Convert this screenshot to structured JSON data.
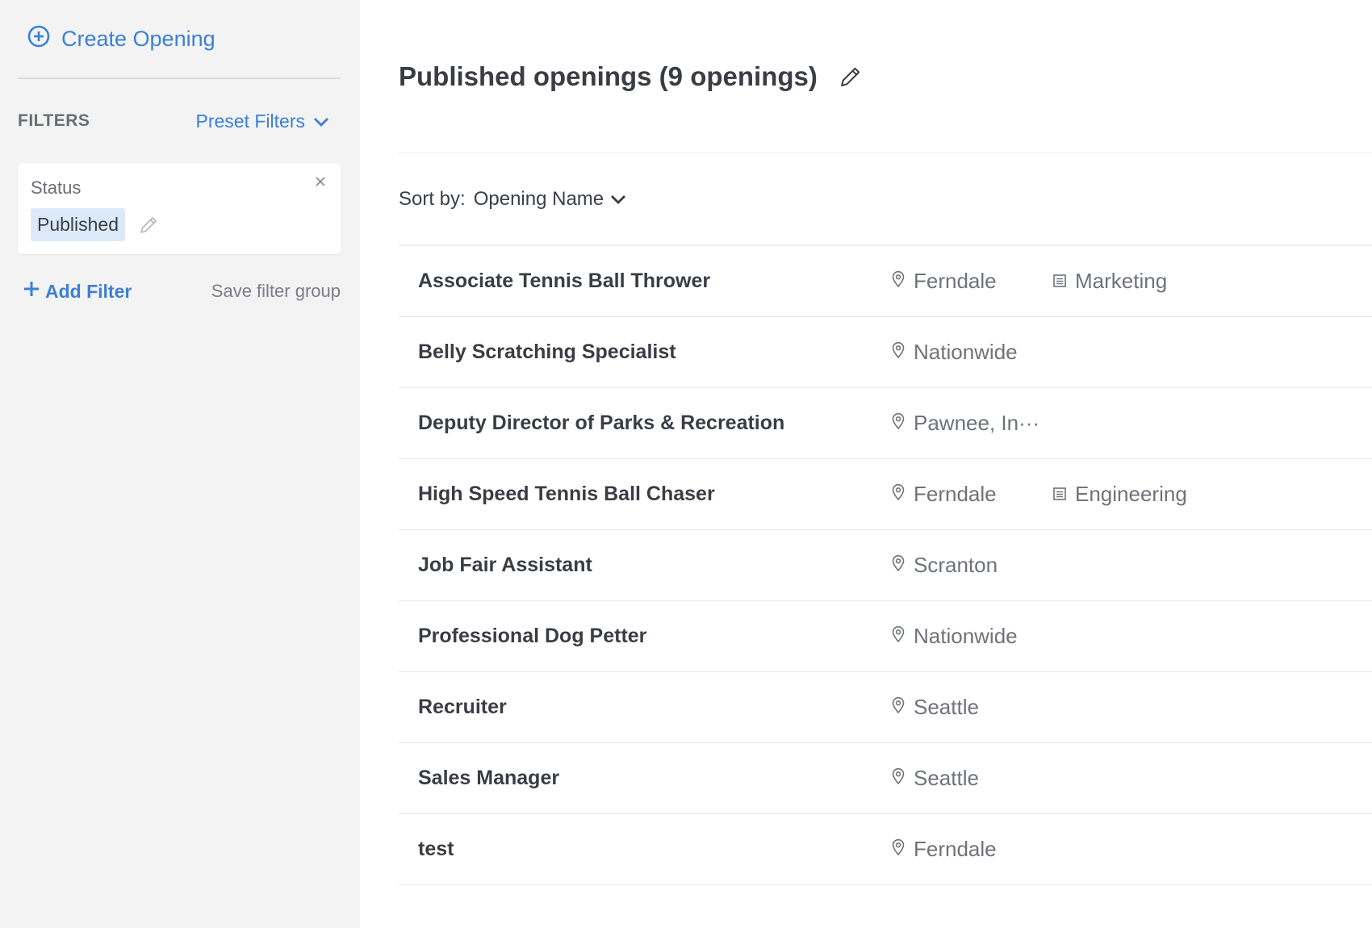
{
  "sidebar": {
    "create_label": "Create Opening",
    "filters_title": "FILTERS",
    "preset_filters_label": "Preset Filters",
    "filter_card": {
      "label": "Status",
      "value": "Published"
    },
    "add_filter_label": "Add Filter",
    "save_filter_group_label": "Save filter group"
  },
  "header": {
    "title": "Published openings (9 openings)"
  },
  "sort": {
    "label": "Sort by:",
    "value": "Opening Name"
  },
  "openings": [
    {
      "name": "Associate Tennis Ball Thrower",
      "location": "Ferndale",
      "department": "Marketing"
    },
    {
      "name": "Belly Scratching Specialist",
      "location": "Nationwide",
      "department": ""
    },
    {
      "name": "Deputy Director of Parks & Recreation",
      "location": "Pawnee, In···",
      "department": ""
    },
    {
      "name": "High Speed Tennis Ball Chaser",
      "location": "Ferndale",
      "department": "Engineering"
    },
    {
      "name": "Job Fair Assistant",
      "location": "Scranton",
      "department": ""
    },
    {
      "name": "Professional Dog Petter",
      "location": "Nationwide",
      "department": ""
    },
    {
      "name": "Recruiter",
      "location": "Seattle",
      "department": ""
    },
    {
      "name": "Sales Manager",
      "location": "Seattle",
      "department": ""
    },
    {
      "name": "test",
      "location": "Ferndale",
      "department": ""
    }
  ],
  "colors": {
    "accent": "#3b7fd6",
    "sidebar_bg": "#f3f3f4",
    "chip_bg": "#dce9f8"
  }
}
